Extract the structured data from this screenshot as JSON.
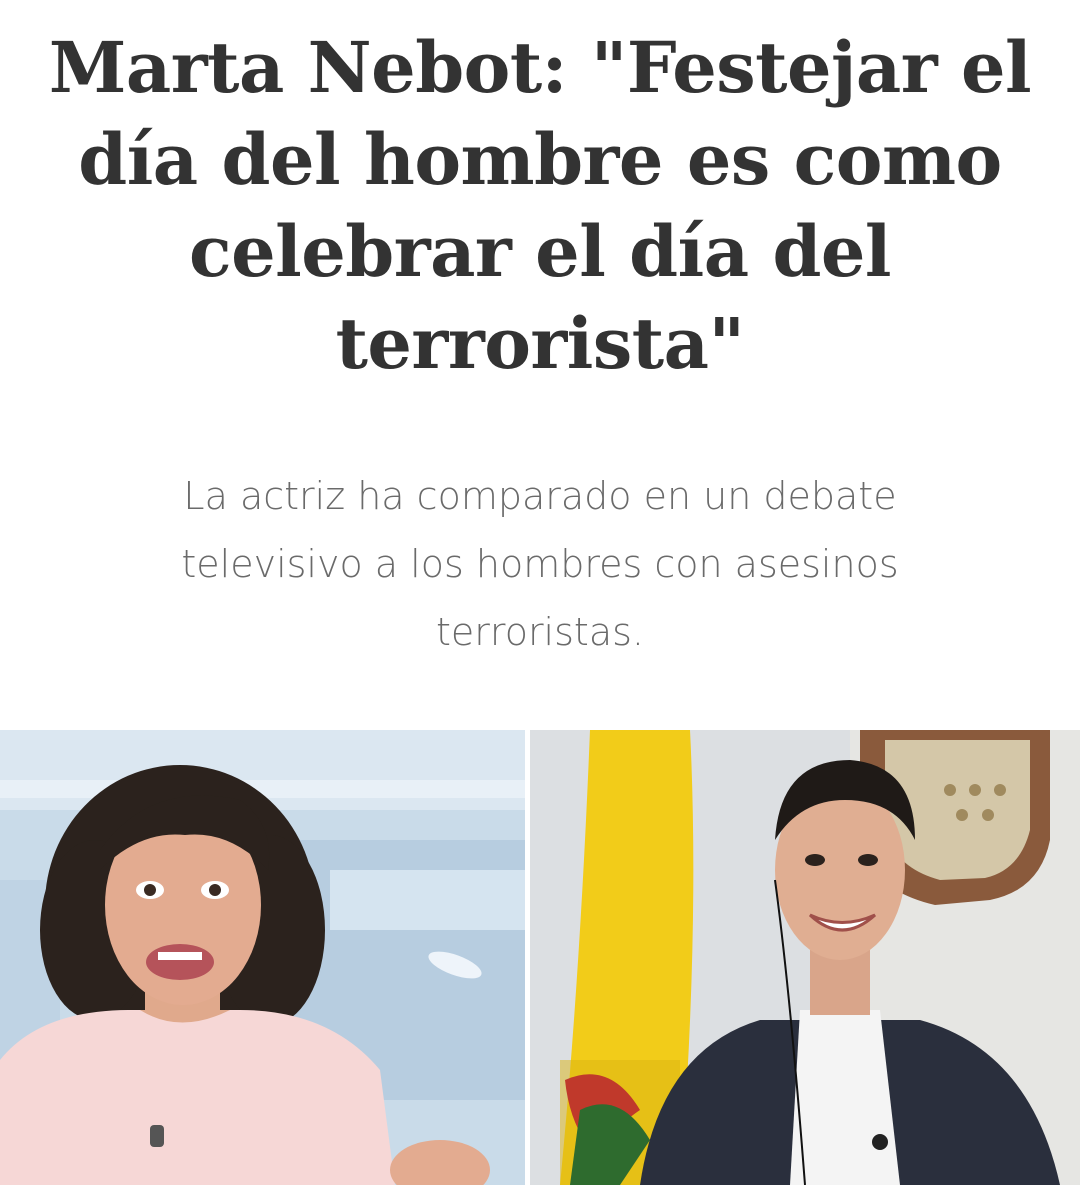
{
  "article": {
    "headline": "Marta Nebot: \"Festejar el día del hombre es como celebrar el día del terrorista\"",
    "subtitle": "La actriz ha comparado en un debate televisivo a los hombres con asesinos terroristas."
  },
  "colors": {
    "headline": "#333333",
    "subtitle": "#6a6a6a",
    "flag_yellow": "#f2cc19",
    "studio_blue": "#c9dbe9"
  }
}
